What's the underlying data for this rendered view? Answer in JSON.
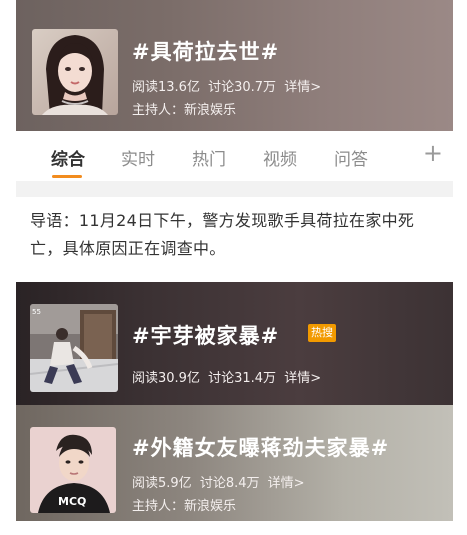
{
  "topics": [
    {
      "title": "#具荷拉去世#",
      "read_label": "阅读13.6亿",
      "discuss_label": "讨论30.7万",
      "detail_label": "详情>",
      "host_label": "主持人：新浪娱乐"
    },
    {
      "title": "#宇芽被家暴#",
      "badge": "热搜",
      "read_label": "阅读30.9亿",
      "discuss_label": "讨论31.4万",
      "detail_label": "详情>"
    },
    {
      "title": "#外籍女友曝蒋劲夫家暴#",
      "read_label": "阅读5.9亿",
      "discuss_label": "讨论8.4万",
      "detail_label": "详情>",
      "host_label": "主持人：新浪娱乐"
    }
  ],
  "tabs": [
    {
      "label": "综合",
      "active": true
    },
    {
      "label": "实时"
    },
    {
      "label": "热门"
    },
    {
      "label": "视频"
    },
    {
      "label": "问答"
    }
  ],
  "tab_plus": "+",
  "intro": {
    "text": "导语：11月24日下午，警方发现歌手具荷拉在家中死亡，具体原因正在调查中。"
  },
  "colors": {
    "accent": "#f28c1e",
    "hot_badge": "#f29a00"
  }
}
